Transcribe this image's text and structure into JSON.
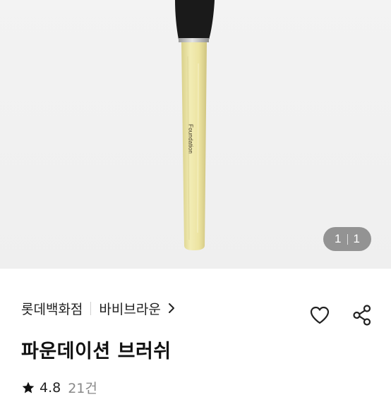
{
  "gallery": {
    "current_page": "1",
    "total_pages": "1",
    "brush_imprint": "Foundation"
  },
  "product": {
    "store": "롯데백화점",
    "brand": "바비브라운",
    "title": "파운데이션 브러쉬",
    "rating": "4.8",
    "review_count": "21건"
  },
  "icons": {
    "brand_arrow": "chevron-right-icon",
    "favorite": "heart-icon",
    "share": "share-icon",
    "rating": "star-icon"
  },
  "colors": {
    "handle": "#EDE6A4",
    "bristles": "#1A1A1A",
    "ferrule": "#C8C8C8"
  }
}
